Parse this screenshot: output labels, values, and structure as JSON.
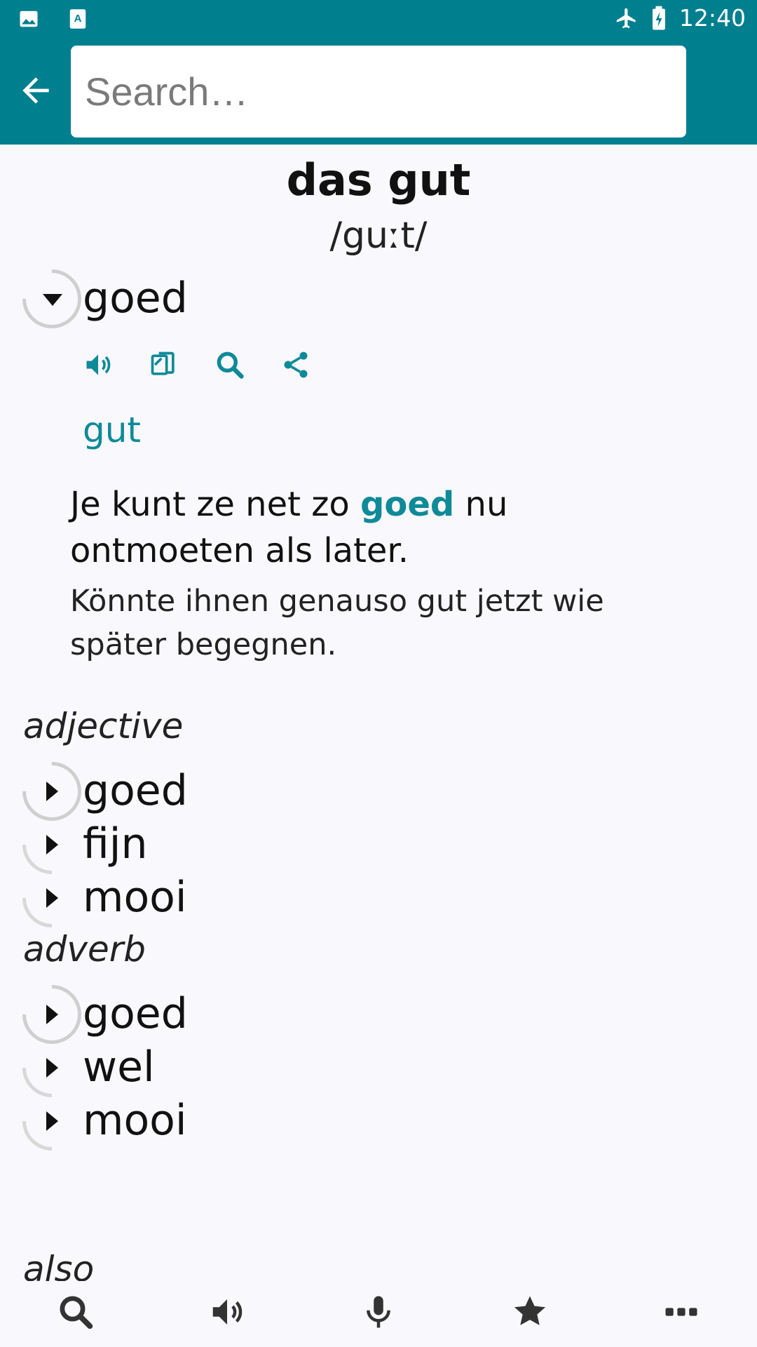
{
  "status_bar": {
    "time": "12:40",
    "icons": [
      "image-icon",
      "app-notification-icon",
      "airplane-mode-icon",
      "battery-charging-icon"
    ]
  },
  "search": {
    "placeholder": "Search…",
    "value": ""
  },
  "entry": {
    "headword": "das gut",
    "phonetic": "/guːt/",
    "expanded": {
      "word": "goed",
      "translation": "gut",
      "example_before": "Je kunt ze net zo ",
      "example_highlight": "goed",
      "example_after": " nu ontmoeten als later.",
      "example_translation": "Könnte ihnen genauso gut jetzt wie später begegnen."
    },
    "sections": [
      {
        "label": "adjective",
        "words": [
          "goed",
          "fijn",
          "mooi"
        ]
      },
      {
        "label": "adverb",
        "words": [
          "goed",
          "wel",
          "mooi"
        ]
      },
      {
        "label": "also"
      }
    ]
  },
  "colors": {
    "accent": "#007f8f",
    "link": "#0e8a98",
    "background": "#f9f8fc"
  },
  "bottom_nav": [
    "search-icon",
    "speaker-icon",
    "microphone-icon",
    "star-icon",
    "more-icon"
  ]
}
